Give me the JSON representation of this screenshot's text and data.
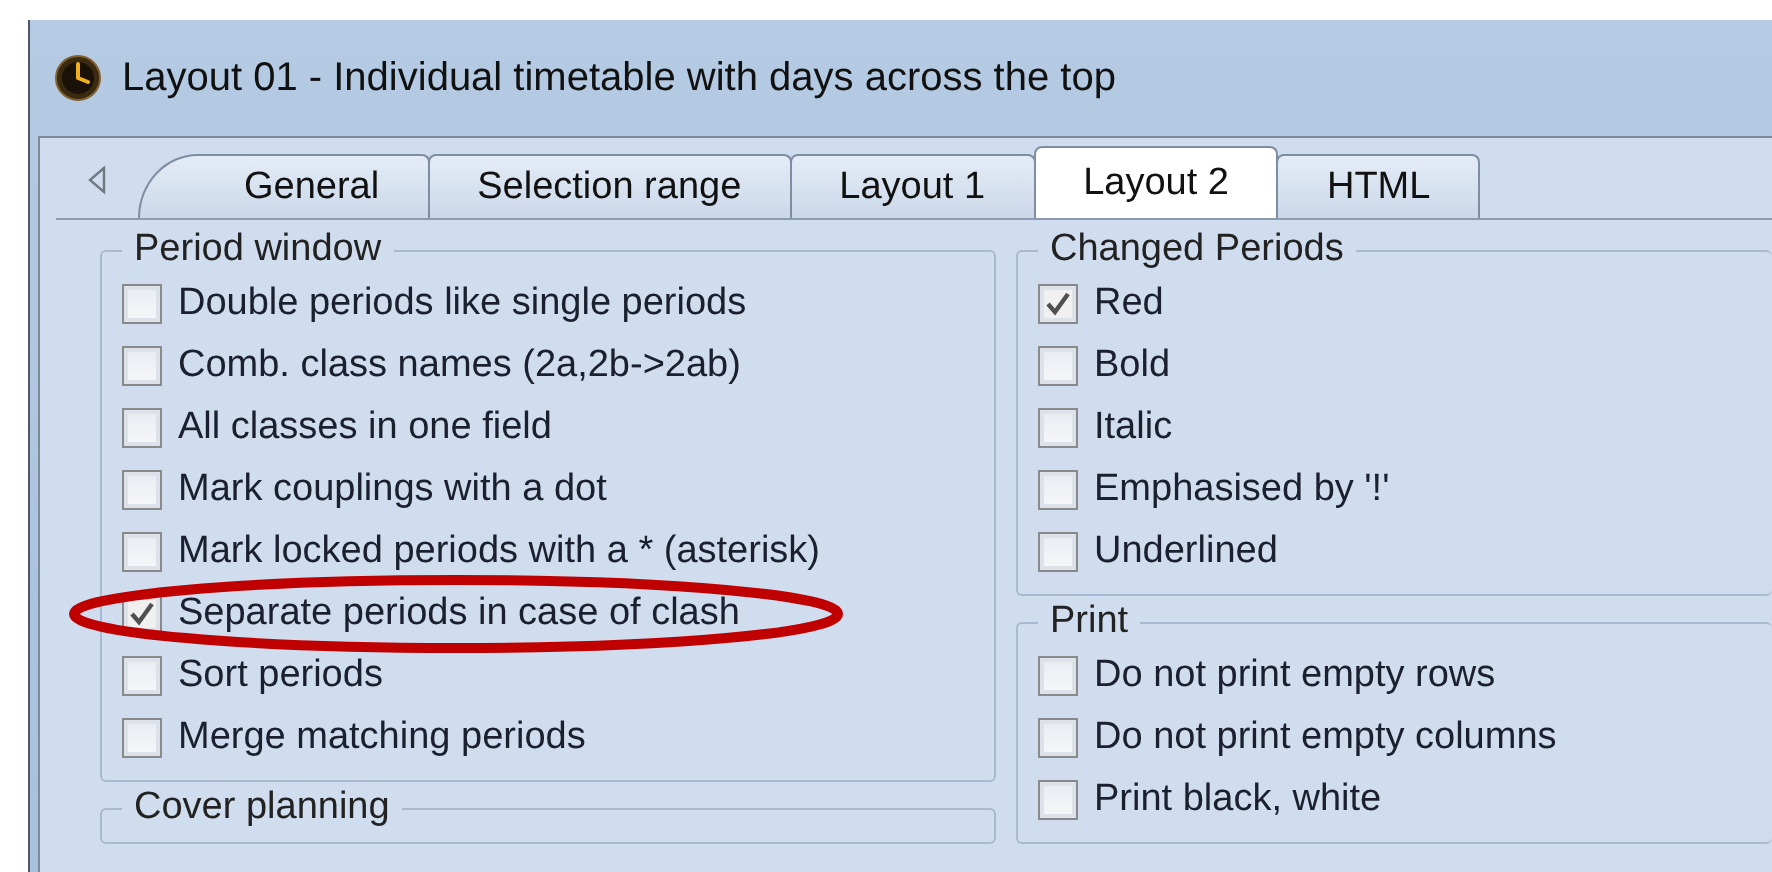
{
  "window": {
    "title": "Layout 01 - Individual timetable with days across the top"
  },
  "tabs": [
    {
      "label": "General",
      "selected": false
    },
    {
      "label": "Selection range",
      "selected": false
    },
    {
      "label": "Layout 1",
      "selected": false
    },
    {
      "label": "Layout 2",
      "selected": true
    },
    {
      "label": "HTML",
      "selected": false
    }
  ],
  "columns": [
    {
      "groups": [
        {
          "title": "Period window",
          "options": [
            {
              "label": "Double periods like single periods",
              "checked": false
            },
            {
              "label": "Comb. class names (2a,2b->2ab)",
              "checked": false
            },
            {
              "label": "All classes in one field",
              "checked": false
            },
            {
              "label": "Mark couplings with a dot",
              "checked": false
            },
            {
              "label": "Mark locked periods with a * (asterisk)",
              "checked": false
            },
            {
              "label": "Separate periods in case of clash",
              "checked": true,
              "highlighted": true
            },
            {
              "label": "Sort periods",
              "checked": false
            },
            {
              "label": "Merge matching periods",
              "checked": false
            }
          ]
        },
        {
          "title": "Cover planning"
        }
      ]
    },
    {
      "groups": [
        {
          "title": "Changed Periods",
          "options": [
            {
              "label": "Red",
              "checked": true
            },
            {
              "label": "Bold",
              "checked": false
            },
            {
              "label": "Italic",
              "checked": false
            },
            {
              "label": "Emphasised by '!'",
              "checked": false
            },
            {
              "label": "Underlined",
              "checked": false
            }
          ]
        },
        {
          "title": "Print",
          "options": [
            {
              "label": "Do not print empty rows",
              "checked": false
            },
            {
              "label": "Do not print empty columns",
              "checked": false
            },
            {
              "label": "Print black, white",
              "checked": false
            }
          ]
        }
      ]
    }
  ]
}
